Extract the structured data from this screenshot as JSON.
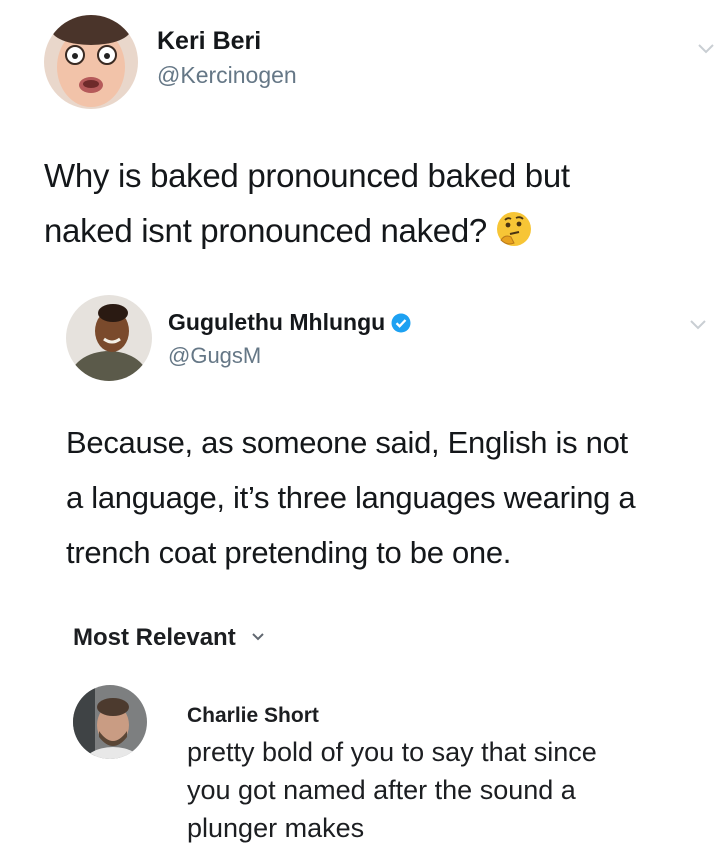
{
  "tweet": {
    "author_name": "Keri Beri",
    "author_handle": "@Kercinogen",
    "text_lines": [
      "Why is baked pronounced baked but",
      "naked isnt pronounced naked?"
    ],
    "emoji": "thinking-face"
  },
  "reply": {
    "author_name": "Gugulethu Mhlungu",
    "author_handle": "@GugsM",
    "verified": true,
    "text_lines": [
      "Because, as someone said, English is not",
      "a language, it’s three languages wearing a",
      "trench coat pretending to be one."
    ]
  },
  "comments_section": {
    "sort_label": "Most Relevant",
    "comments": [
      {
        "author_name": "Charlie Short",
        "text_lines": [
          "pretty bold of you to say that since",
          "you got named after the sound a",
          "plunger makes"
        ]
      }
    ]
  },
  "colors": {
    "text": "#14171a",
    "handle": "#657786",
    "verified": "#1da1f2"
  }
}
